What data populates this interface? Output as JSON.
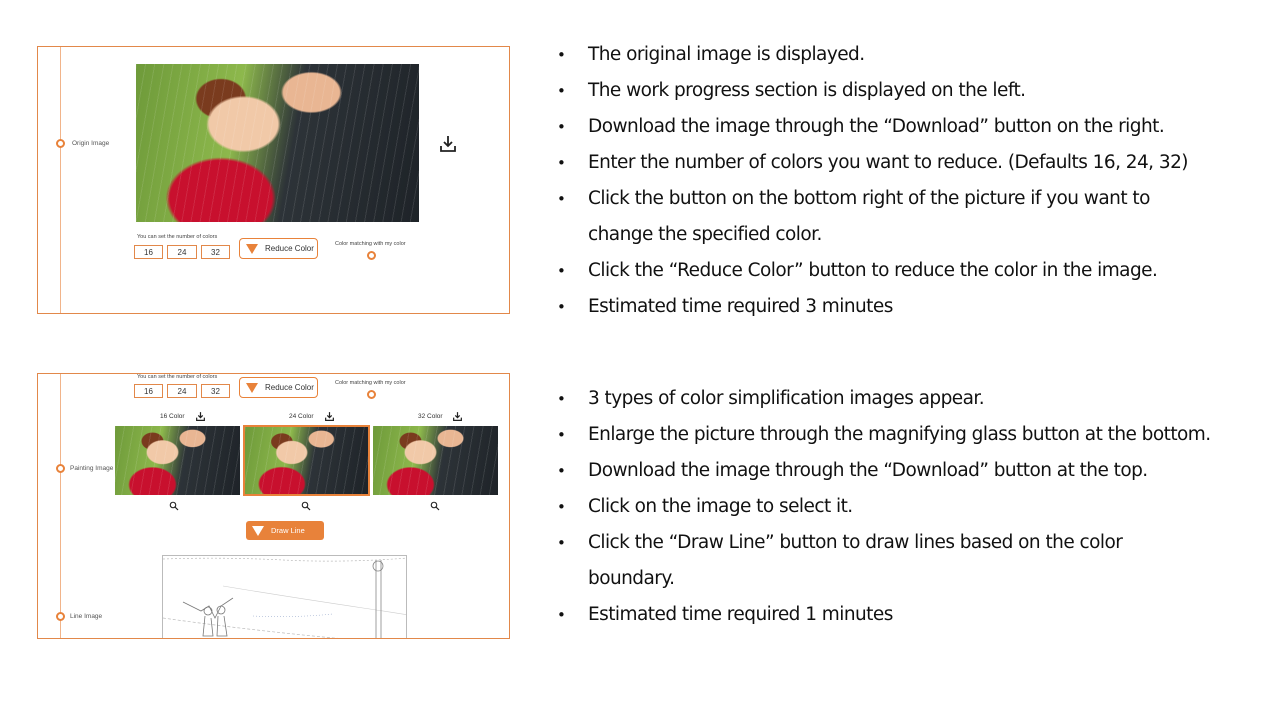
{
  "panel_top": {
    "step_label": "Origin Image",
    "colors_hint": "You can set the number of colors",
    "color_options": [
      "16",
      "24",
      "32"
    ],
    "reduce_button": "Reduce Color",
    "color_match_label": "Color matching with my color",
    "download_icon": "download-icon"
  },
  "panel_bottom": {
    "colors_hint": "You can set the number of colors",
    "color_options": [
      "16",
      "24",
      "32"
    ],
    "reduce_button": "Reduce Color",
    "color_match_label": "Color matching with my color",
    "painting_label": "Painting Image",
    "line_label": "Line Image",
    "thumbnails": [
      {
        "label": "16 Color"
      },
      {
        "label": "24 Color"
      },
      {
        "label": "32 Color"
      }
    ],
    "draw_button": "Draw Line",
    "accent_color": "#e8823a"
  },
  "bullets_top": [
    "The original image is displayed.",
    "The work progress section is displayed on the left.",
    "Download the image through the “Download” button on the right.",
    "Enter the number of colors you want to reduce. (Defaults 16, 24, 32)",
    "Click the button on the bottom right of the picture if you want to",
    "change the specified color.",
    "Click the “Reduce Color” button to reduce the color in the image.",
    "Estimated time required 3 minutes"
  ],
  "bullets_bottom": [
    "3 types of color simplification images appear.",
    "Enlarge the picture through the magnifying glass button at the bottom.",
    "Download the image through the “Download” button at the top.",
    "Click on the image to select it.",
    "Click the “Draw Line” button to draw lines based on the color",
    "boundary.",
    "Estimated time required 1 minutes"
  ]
}
